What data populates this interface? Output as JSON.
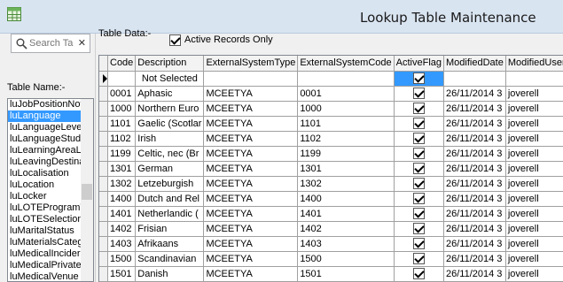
{
  "window": {
    "title": "Lookup Table Maintenance"
  },
  "search": {
    "placeholder": "Search Ta",
    "value": ""
  },
  "left": {
    "table_name_label": "Table Name:-",
    "tables": [
      "luJobPositionNot",
      "luLanguage",
      "luLanguageLeve",
      "luLanguageStud",
      "luLearningAreaL",
      "luLeavingDestina",
      "luLocalisation",
      "luLocation",
      "luLocker",
      "luLOTEProgramT",
      "luLOTESelection",
      "luMaritalStatus",
      "luMaterialsCateg",
      "luMedicalIncider",
      "luMedicalPrivate",
      "luMedicalVenue"
    ],
    "selected_table": "luLanguage"
  },
  "right": {
    "table_data_label": "Table Data:-",
    "active_only_label": "Active Records Only",
    "active_only_checked": true
  },
  "grid": {
    "columns": [
      "Code",
      "Description",
      "ExternalSystemType",
      "ExternalSystemCode",
      "ActiveFlag",
      "ModifiedDate",
      "ModifiedUser"
    ],
    "rows": [
      {
        "code": "",
        "description": "Not Selected",
        "ext_type": "",
        "ext_code": "",
        "active": true,
        "modified_date": "",
        "modified_user": "",
        "current": true
      },
      {
        "code": "0001",
        "description": "Aphasic",
        "ext_type": "MCEETYA",
        "ext_code": "0001",
        "active": true,
        "modified_date": "26/11/2014 3",
        "modified_user": "joverell"
      },
      {
        "code": "1000",
        "description": "Northern Euro",
        "ext_type": "MCEETYA",
        "ext_code": "1000",
        "active": true,
        "modified_date": "26/11/2014 3",
        "modified_user": "joverell"
      },
      {
        "code": "1101",
        "description": "Gaelic (Scotlar",
        "ext_type": "MCEETYA",
        "ext_code": "1101",
        "active": true,
        "modified_date": "26/11/2014 3",
        "modified_user": "joverell"
      },
      {
        "code": "1102",
        "description": "Irish",
        "ext_type": "MCEETYA",
        "ext_code": "1102",
        "active": true,
        "modified_date": "26/11/2014 3",
        "modified_user": "joverell"
      },
      {
        "code": "1199",
        "description": "Celtic, nec (Br",
        "ext_type": "MCEETYA",
        "ext_code": "1199",
        "active": true,
        "modified_date": "26/11/2014 3",
        "modified_user": "joverell"
      },
      {
        "code": "1301",
        "description": "German",
        "ext_type": "MCEETYA",
        "ext_code": "1301",
        "active": true,
        "modified_date": "26/11/2014 3",
        "modified_user": "joverell"
      },
      {
        "code": "1302",
        "description": "Letzeburgish",
        "ext_type": "MCEETYA",
        "ext_code": "1302",
        "active": true,
        "modified_date": "26/11/2014 3",
        "modified_user": "joverell"
      },
      {
        "code": "1400",
        "description": "Dutch and Rel",
        "ext_type": "MCEETYA",
        "ext_code": "1400",
        "active": true,
        "modified_date": "26/11/2014 3",
        "modified_user": "joverell"
      },
      {
        "code": "1401",
        "description": "Netherlandic (",
        "ext_type": "MCEETYA",
        "ext_code": "1401",
        "active": true,
        "modified_date": "26/11/2014 3",
        "modified_user": "joverell"
      },
      {
        "code": "1402",
        "description": "Frisian",
        "ext_type": "MCEETYA",
        "ext_code": "1402",
        "active": true,
        "modified_date": "26/11/2014 3",
        "modified_user": "joverell"
      },
      {
        "code": "1403",
        "description": "Afrikaans",
        "ext_type": "MCEETYA",
        "ext_code": "1403",
        "active": true,
        "modified_date": "26/11/2014 3",
        "modified_user": "joverell"
      },
      {
        "code": "1500",
        "description": "Scandinavian",
        "ext_type": "MCEETYA",
        "ext_code": "1500",
        "active": true,
        "modified_date": "26/11/2014 3",
        "modified_user": "joverell"
      },
      {
        "code": "1501",
        "description": "Danish",
        "ext_type": "MCEETYA",
        "ext_code": "1501",
        "active": true,
        "modified_date": "26/11/2014 3",
        "modified_user": "joverell"
      }
    ]
  },
  "colors": {
    "selection": "#3399ff",
    "titlebar": "#d9e4f1"
  }
}
